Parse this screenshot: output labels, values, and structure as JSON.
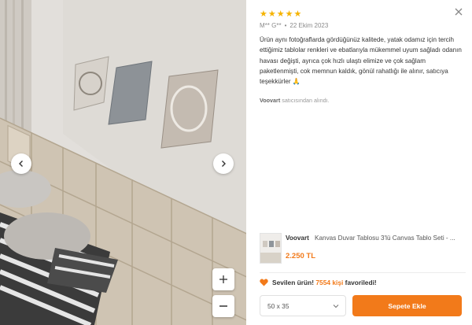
{
  "review": {
    "stars": [
      "★",
      "★",
      "★",
      "★",
      "★"
    ],
    "author": "M** G**",
    "separator": "•",
    "date": "22 Ekim 2023",
    "text": "Ürün aynı fotoğraflarda gördüğünüz kalitede, yatak odamız için tercih ettiğimiz tablolar renkleri ve ebatlarıyla mükemmel uyum sağladı odanın havası değişti, ayrıca çok hızlı ulaştı elimize ve çok sağlam paketlenmişti, cok memnun kaldık, gönül rahatlığı ile alınır, satıcıya teşekkürler 🙏",
    "seller_name": "Voovart",
    "seller_suffix": " satıcısından alındı."
  },
  "product": {
    "brand": "Voovart",
    "title": "Kanvas Duvar Tablosu 3'lü Canvas Tablo Seti - ...",
    "price": "2.250 TL"
  },
  "favorite": {
    "label": "Sevilen ürün!",
    "count": "7554 kişi",
    "suffix": "favoriledi!"
  },
  "size_select": {
    "value": "50 x 35"
  },
  "cart_button": {
    "label": "Sepete Ekle"
  },
  "colors": {
    "accent": "#f27a1a",
    "star": "#f5b301"
  },
  "icons": [
    "close-icon",
    "chevron-left-icon",
    "chevron-right-icon",
    "plus-icon",
    "minus-icon",
    "heart-icon",
    "chevron-down-icon"
  ]
}
